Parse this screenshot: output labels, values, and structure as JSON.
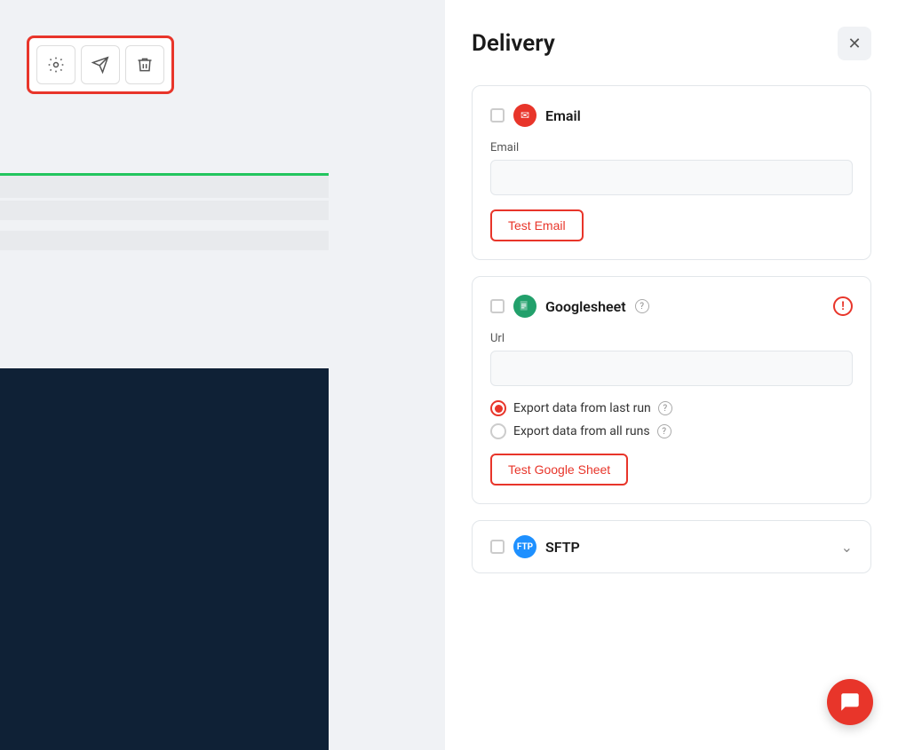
{
  "header": {
    "title": "Delivery",
    "close_label": "×"
  },
  "toolbar": {
    "gear_label": "settings",
    "send_label": "send",
    "trash_label": "delete"
  },
  "email_section": {
    "label": "Email",
    "field_label": "Email",
    "field_placeholder": "",
    "test_btn": "Test Email",
    "checked": false
  },
  "googlesheet_section": {
    "label": "Googlesheet",
    "url_label": "Url",
    "url_placeholder": "",
    "export_last_run": "Export data from last run",
    "export_all_runs": "Export data from all runs",
    "test_btn": "Test Google Sheet",
    "checked": false,
    "has_warning": true
  },
  "sftp_section": {
    "label": "SFTP",
    "checked": false
  },
  "radios": {
    "last_run_selected": true,
    "all_runs_selected": false
  }
}
